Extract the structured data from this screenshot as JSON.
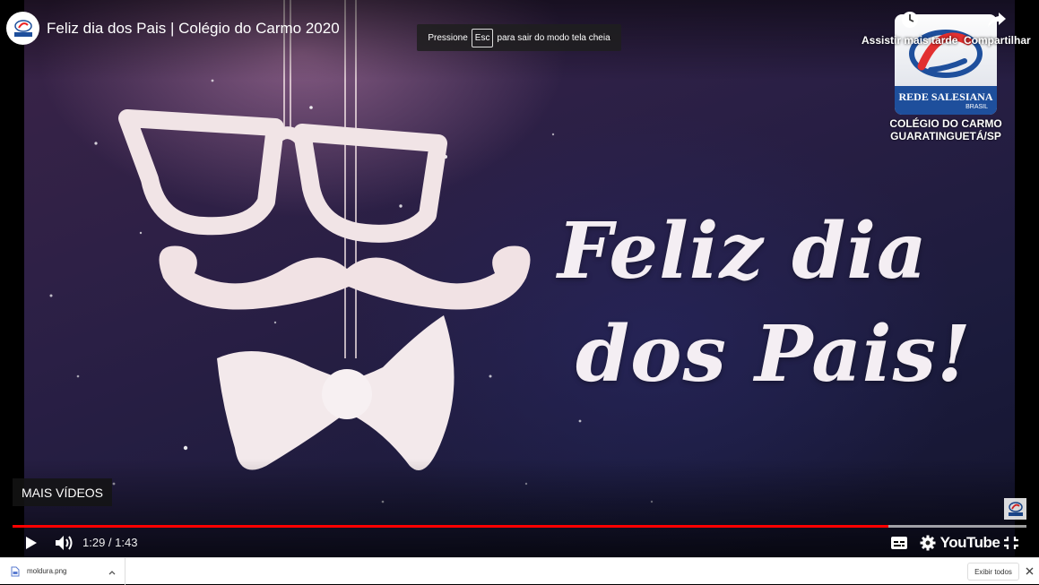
{
  "header": {
    "title": "Feliz dia dos Pais | Colégio do Carmo 2020",
    "watch_later_label": "Assistir mais tarde",
    "share_label": "Compartilhar"
  },
  "fullscreen_tip": {
    "before": "Pressione",
    "key": "Esc",
    "after": "para sair do modo tela cheia"
  },
  "video": {
    "line1": "Feliz dia",
    "line2": "dos Pais!",
    "logo_brand": "REDE SALESIANA",
    "logo_country": "BRASIL",
    "logo_school_line1": "COLÉGIO DO CARMO",
    "logo_school_line2": "GUARATINGUETÁ/SP"
  },
  "end_screen": {
    "more_videos": "MAIS VÍDEOS"
  },
  "player": {
    "current_time": "1:29",
    "duration": "1:43",
    "time_display": "1:29 / 1:43",
    "progress_fraction": 0.864,
    "buffer_fraction": 1.0,
    "progress_color": "#ff0000",
    "brand_label": "YouTube"
  },
  "icons": {
    "play": "play-icon",
    "volume": "volume-icon",
    "subtitles": "subtitles-icon",
    "settings": "gear-icon",
    "exit_fullscreen": "exit-fullscreen-icon",
    "watch_later": "clock-icon",
    "share": "share-arrow-icon"
  },
  "download_bar": {
    "file_name": "moldura.png",
    "show_all_label": "Exibir todos"
  }
}
